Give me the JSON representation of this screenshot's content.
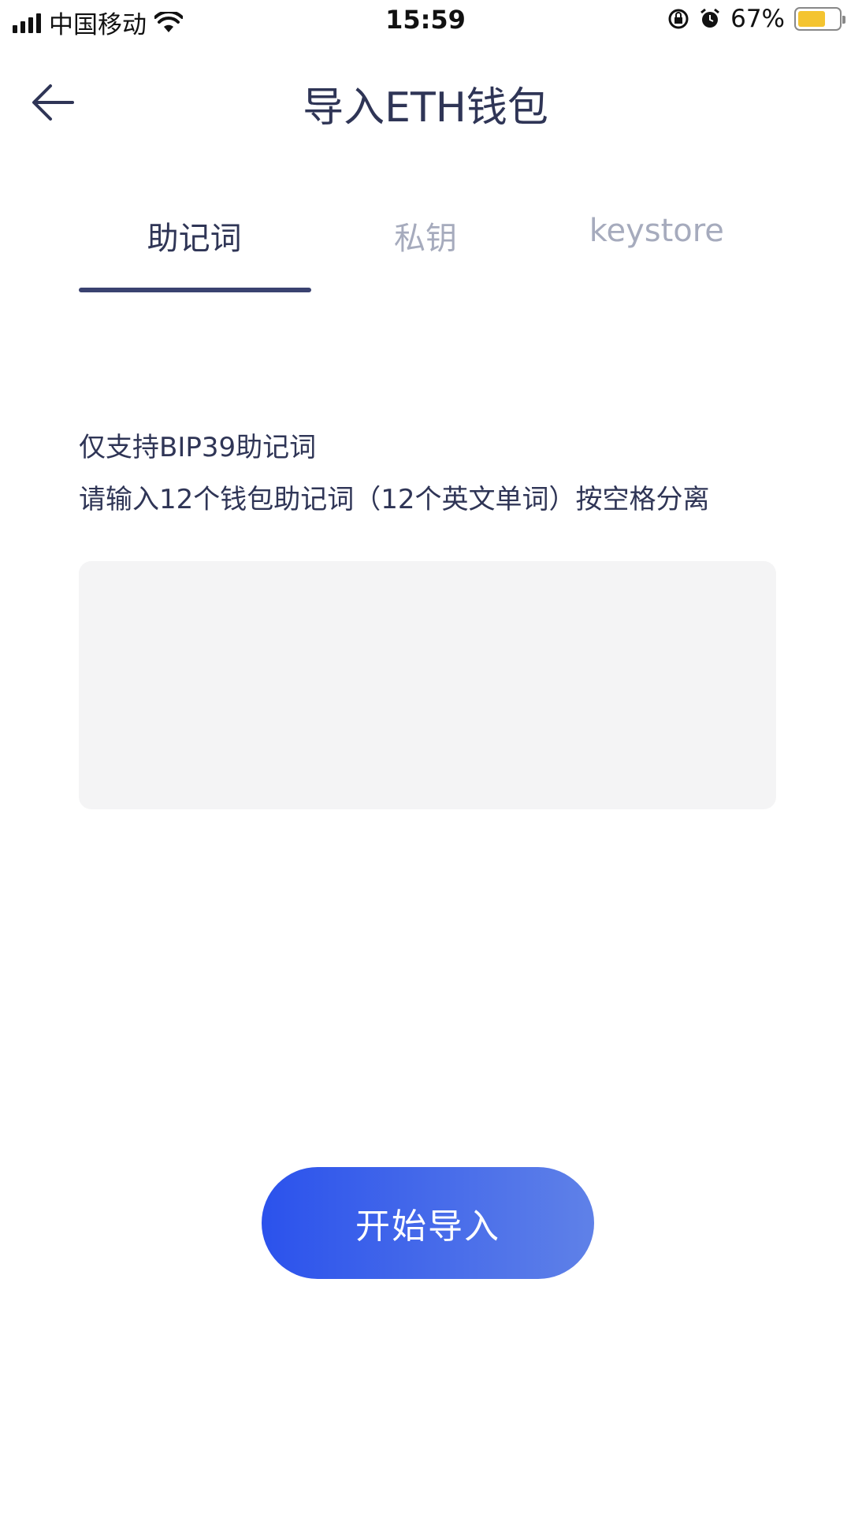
{
  "status_bar": {
    "carrier": "中国移动",
    "time": "15:59",
    "battery_percent": "67%",
    "battery_level": 0.67,
    "battery_color": "#f4c430",
    "icons": [
      "signal-icon",
      "wifi-icon",
      "rotation-lock-icon",
      "alarm-icon",
      "battery-icon"
    ]
  },
  "nav": {
    "title": "导入ETH钱包",
    "back_icon": "back-arrow-icon"
  },
  "tabs": [
    {
      "label": "助记词",
      "active": true
    },
    {
      "label": "私钥",
      "active": false
    },
    {
      "label": "keystore",
      "active": false
    }
  ],
  "instructions": {
    "line1": "仅支持BIP39助记词",
    "line2": "请输入12个钱包助记词（12个英文单词）按空格分离"
  },
  "mnemonic_input": {
    "value": "",
    "placeholder": ""
  },
  "import_button": {
    "label": "开始导入",
    "gradient_start": "#2b52ec",
    "gradient_end": "#5f81e8"
  },
  "colors": {
    "primary_text": "#2f3556",
    "inactive_tab": "#a6abbd",
    "tab_indicator": "#3a4270",
    "input_bg": "#f4f4f5"
  }
}
